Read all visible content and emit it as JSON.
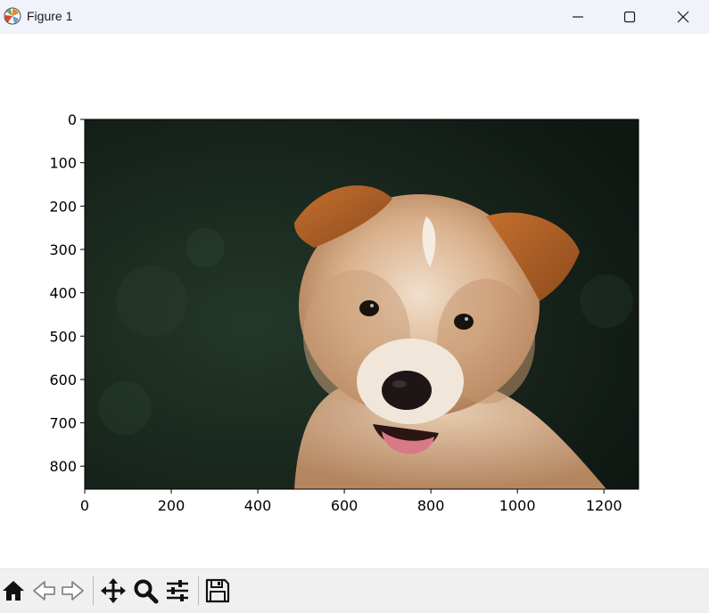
{
  "window": {
    "title": "Figure 1",
    "icons": {
      "app": "matplotlib-icon",
      "minimize": "minimize-icon",
      "maximize": "maximize-icon",
      "close": "close-icon"
    }
  },
  "figure": {
    "image_description_name": "puppy-photo",
    "image_extent": {
      "width": 1280,
      "height": 853
    },
    "x_ticks": [
      "0",
      "200",
      "400",
      "600",
      "800",
      "1000",
      "1200"
    ],
    "y_ticks": [
      "0",
      "100",
      "200",
      "300",
      "400",
      "500",
      "600",
      "700",
      "800"
    ]
  },
  "toolbar": {
    "tools": [
      {
        "name": "home-icon"
      },
      {
        "name": "back-icon"
      },
      {
        "name": "forward-icon"
      },
      {
        "name": "pan-icon"
      },
      {
        "name": "zoom-icon"
      },
      {
        "name": "configure-subplots-icon"
      },
      {
        "name": "save-icon"
      }
    ]
  },
  "colors": {
    "titlebar": "#f0f3f9",
    "toolbar": "#f0f0f0",
    "background_dark": "#1b2a1f",
    "fur": "#c99a72",
    "ear": "#b9622a"
  }
}
